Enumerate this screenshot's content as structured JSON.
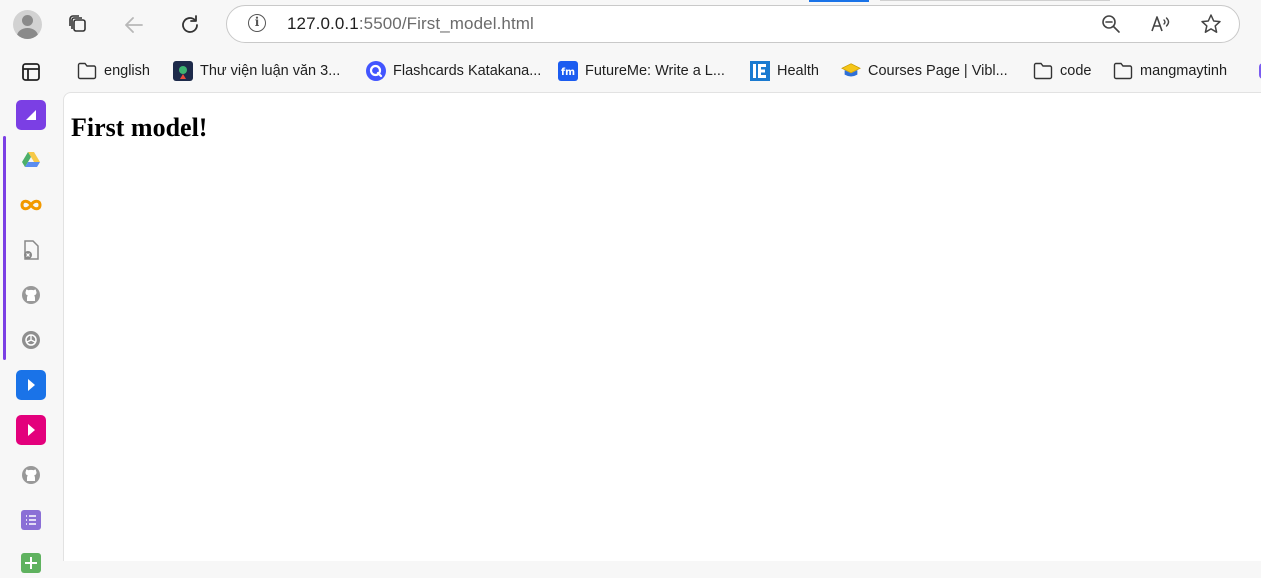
{
  "browser": {
    "address_bar": {
      "url_host": "127.0.0.1",
      "url_rest": ":5500/First_model.html"
    }
  },
  "bookmarks": [
    {
      "label": "english",
      "icon": "folder-icon"
    },
    {
      "label": "Thư viện luận văn 3...",
      "icon": "thuvien-favicon"
    },
    {
      "label": "Flashcards Katakana...",
      "icon": "quizlet-favicon"
    },
    {
      "label": "FutureMe: Write a L...",
      "icon": "futureme-favicon"
    },
    {
      "label": "Health",
      "icon": "ie-favicon"
    },
    {
      "label": "Courses Page | Vibl...",
      "icon": "viblo-favicon"
    },
    {
      "label": "code",
      "icon": "folder-icon"
    },
    {
      "label": "mangmaytinh",
      "icon": "folder-icon"
    }
  ],
  "sidebar": {
    "items": [
      {
        "name": "workspaces-icon"
      },
      {
        "name": "purple-app-icon",
        "color": "#7b3fe4"
      },
      {
        "name": "google-drive-icon"
      },
      {
        "name": "infinity-icon",
        "color": "#f29900"
      },
      {
        "name": "file-blocked-icon"
      },
      {
        "name": "github-icon"
      },
      {
        "name": "chatgpt-icon"
      },
      {
        "name": "blue-play-icon",
        "color": "#1a73e8"
      },
      {
        "name": "pink-play-icon",
        "color": "#e3007c"
      },
      {
        "name": "github-icon-2"
      },
      {
        "name": "list-app-icon",
        "color": "#8b6fd6"
      },
      {
        "name": "green-app-icon",
        "color": "#5fb25f"
      }
    ]
  },
  "page": {
    "heading": "First model!"
  }
}
